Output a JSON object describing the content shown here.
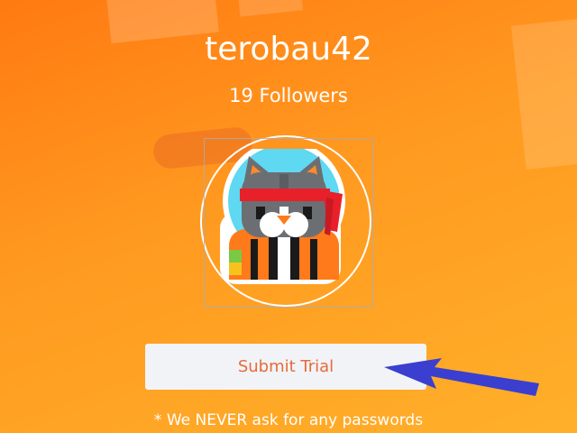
{
  "profile": {
    "username": "terobau42",
    "followers": "19 Followers"
  },
  "avatar": {
    "icon": "ninja-cat-avatar-icon"
  },
  "actions": {
    "submit_label": "Submit Trial"
  },
  "footer": {
    "disclaimer": "* We NEVER ask for any passwords"
  },
  "colors": {
    "background_start": "#ff7a12",
    "background_end": "#ffb02a",
    "button_bg": "#f2f3f6",
    "button_text": "#e56b3a",
    "annotation_arrow": "#3a3fd0"
  }
}
